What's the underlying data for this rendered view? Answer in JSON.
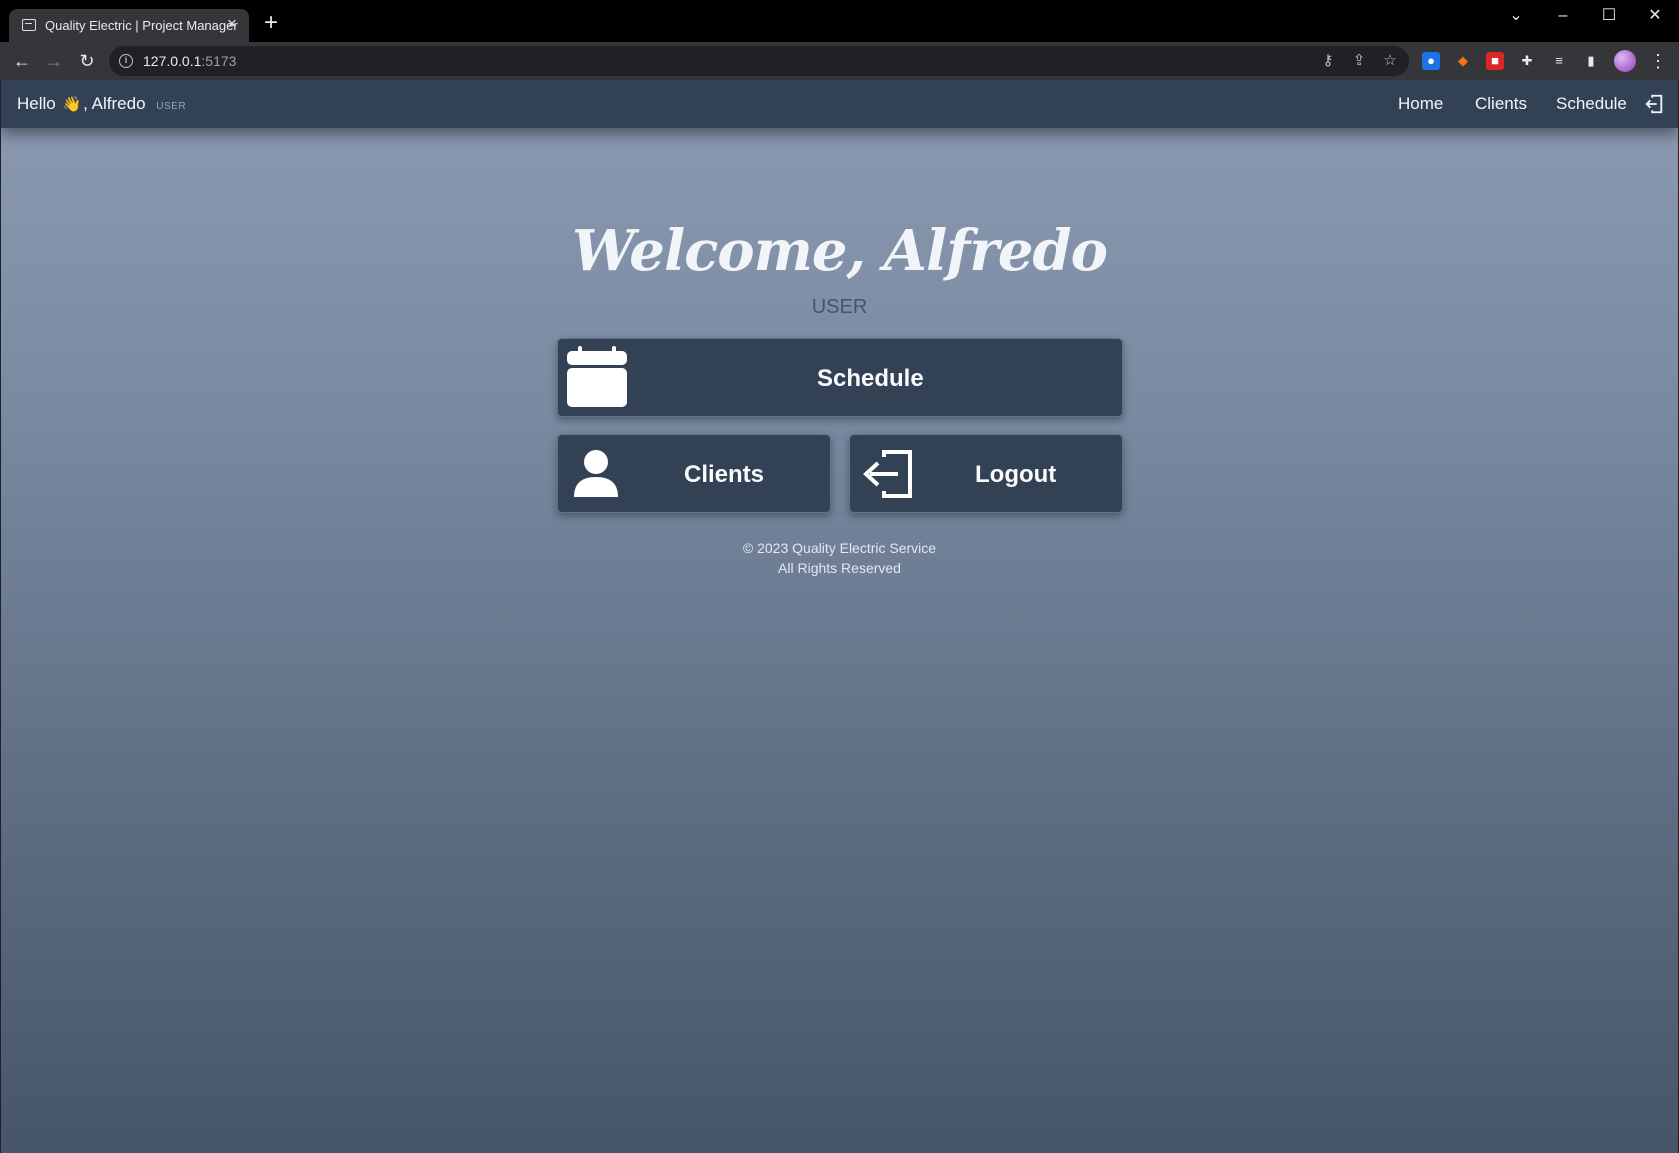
{
  "browser": {
    "tab_title": "Quality Electric | Project Manager",
    "url_host": "127.0.0.1",
    "url_port": ":5173"
  },
  "navbar": {
    "greeting_prefix": "Hello",
    "wave_emoji": "👋",
    "greeting_name": ", Alfredo",
    "role": "USER",
    "links": [
      "Home",
      "Clients",
      "Schedule"
    ]
  },
  "hero": {
    "title": "Welcome, Alfredo",
    "role": "USER"
  },
  "actions": {
    "schedule": "Schedule",
    "clients": "Clients",
    "logout": "Logout"
  },
  "footer": {
    "line1": "© 2023 Quality Electric Service",
    "line2": "All Rights Reserved"
  },
  "colors": {
    "navbar_bg": "#334155",
    "card_bg": "#334155",
    "gradient_top": "#8c9bb2",
    "gradient_bottom": "#475569"
  }
}
